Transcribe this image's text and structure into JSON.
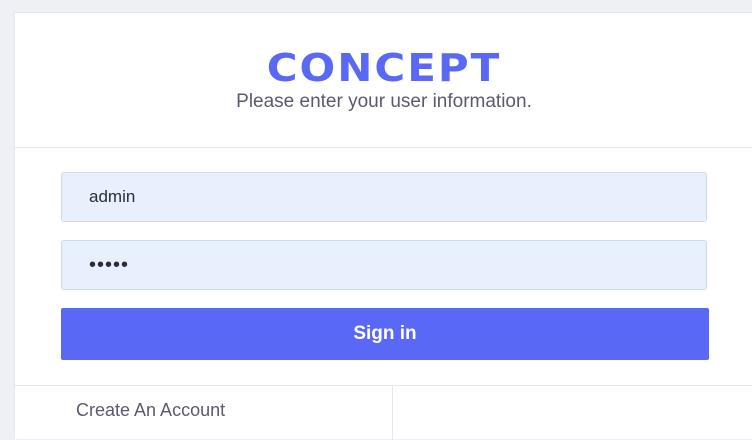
{
  "header": {
    "logo": "CONCEPT",
    "subtitle": "Please enter your user information."
  },
  "form": {
    "username_value": "admin",
    "password_value": "•••••",
    "signin_label": "Sign in"
  },
  "footer": {
    "create_account_label": "Create An Account"
  },
  "colors": {
    "accent": "#5969f5",
    "input_bg": "#e8effd"
  }
}
